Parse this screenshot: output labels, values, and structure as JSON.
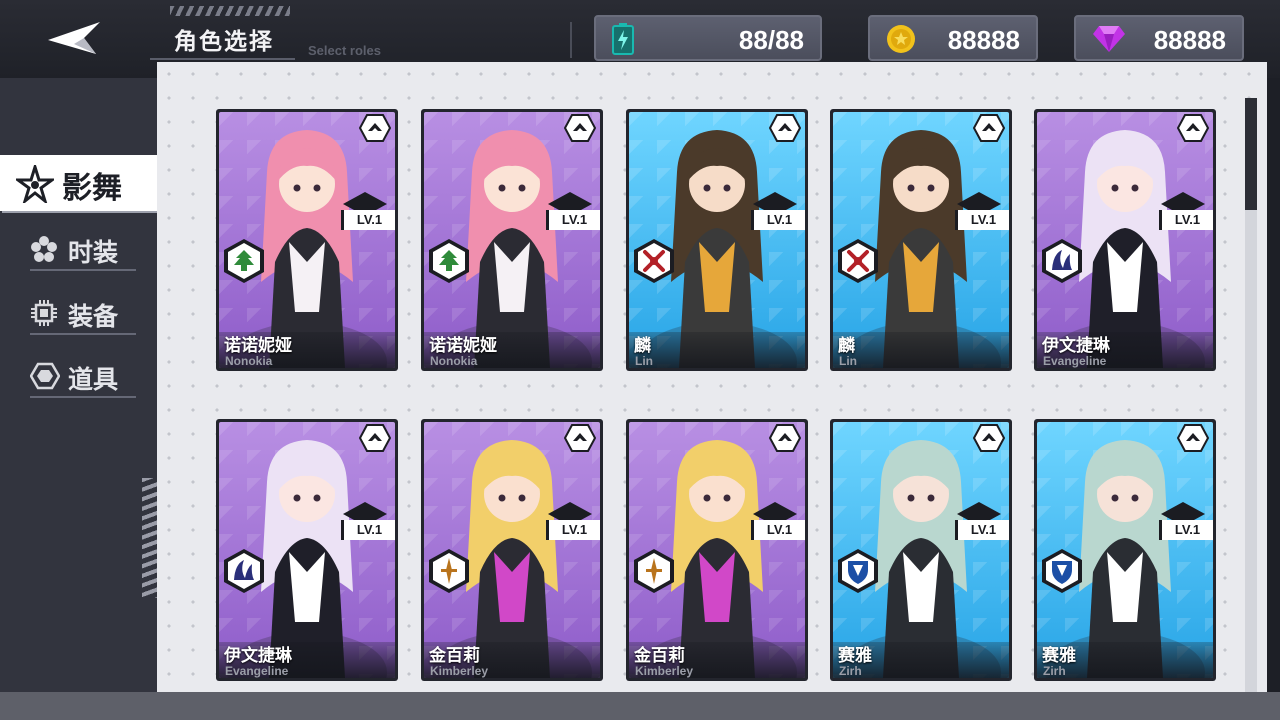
{
  "header": {
    "title_cn": "角色选择",
    "title_en": "Select roles"
  },
  "resources": {
    "energy": {
      "value": "88/88",
      "icon": "battery-icon",
      "color": "#19b9b0"
    },
    "gold": {
      "value": "88888",
      "icon": "gold-coin-icon",
      "color": "#f2c21b"
    },
    "gems": {
      "value": "88888",
      "icon": "purple-gem-icon",
      "color": "#c233e6"
    }
  },
  "sidebar": {
    "items": [
      {
        "label": "影舞",
        "icon": "star-emblem-icon",
        "active": true
      },
      {
        "label": "时装",
        "icon": "flower-icon",
        "active": false
      },
      {
        "label": "装备",
        "icon": "chip-icon",
        "active": false
      },
      {
        "label": "道具",
        "icon": "hexagon-icon",
        "active": false
      }
    ]
  },
  "cards": [
    {
      "name_cn": "诺诺妮娅",
      "name_en": "Nonokia",
      "level": "LV.1",
      "theme": "purple",
      "class_icon": "tree-shield-icon",
      "class_color": "#2f8b3a"
    },
    {
      "name_cn": "诺诺妮娅",
      "name_en": "Nonokia",
      "level": "LV.1",
      "theme": "purple",
      "class_icon": "tree-shield-icon",
      "class_color": "#2f8b3a"
    },
    {
      "name_cn": "麟",
      "name_en": "Lin",
      "level": "LV.1",
      "theme": "blue",
      "class_icon": "crossed-swords-icon",
      "class_color": "#b32027"
    },
    {
      "name_cn": "麟",
      "name_en": "Lin",
      "level": "LV.1",
      "theme": "blue",
      "class_icon": "crossed-swords-icon",
      "class_color": "#b32027"
    },
    {
      "name_cn": "伊文捷琳",
      "name_en": "Evangeline",
      "level": "LV.1",
      "theme": "purple",
      "class_icon": "wave-emblem-icon",
      "class_color": "#2a2f7a"
    },
    {
      "name_cn": "伊文捷琳",
      "name_en": "Evangeline",
      "level": "LV.1",
      "theme": "purple",
      "class_icon": "wave-emblem-icon",
      "class_color": "#2a2f7a"
    },
    {
      "name_cn": "金百莉",
      "name_en": "Kimberley",
      "level": "LV.1",
      "theme": "purple",
      "class_icon": "dagger-icon",
      "class_color": "#b9741d"
    },
    {
      "name_cn": "金百莉",
      "name_en": "Kimberley",
      "level": "LV.1",
      "theme": "purple",
      "class_icon": "dagger-icon",
      "class_color": "#b9741d"
    },
    {
      "name_cn": "赛雅",
      "name_en": "Zirh",
      "level": "LV.1",
      "theme": "blue",
      "class_icon": "shield-emblem-icon",
      "class_color": "#1c4fa6"
    },
    {
      "name_cn": "赛雅",
      "name_en": "Zirh",
      "level": "LV.1",
      "theme": "blue",
      "class_icon": "shield-emblem-icon",
      "class_color": "#1c4fa6"
    }
  ]
}
